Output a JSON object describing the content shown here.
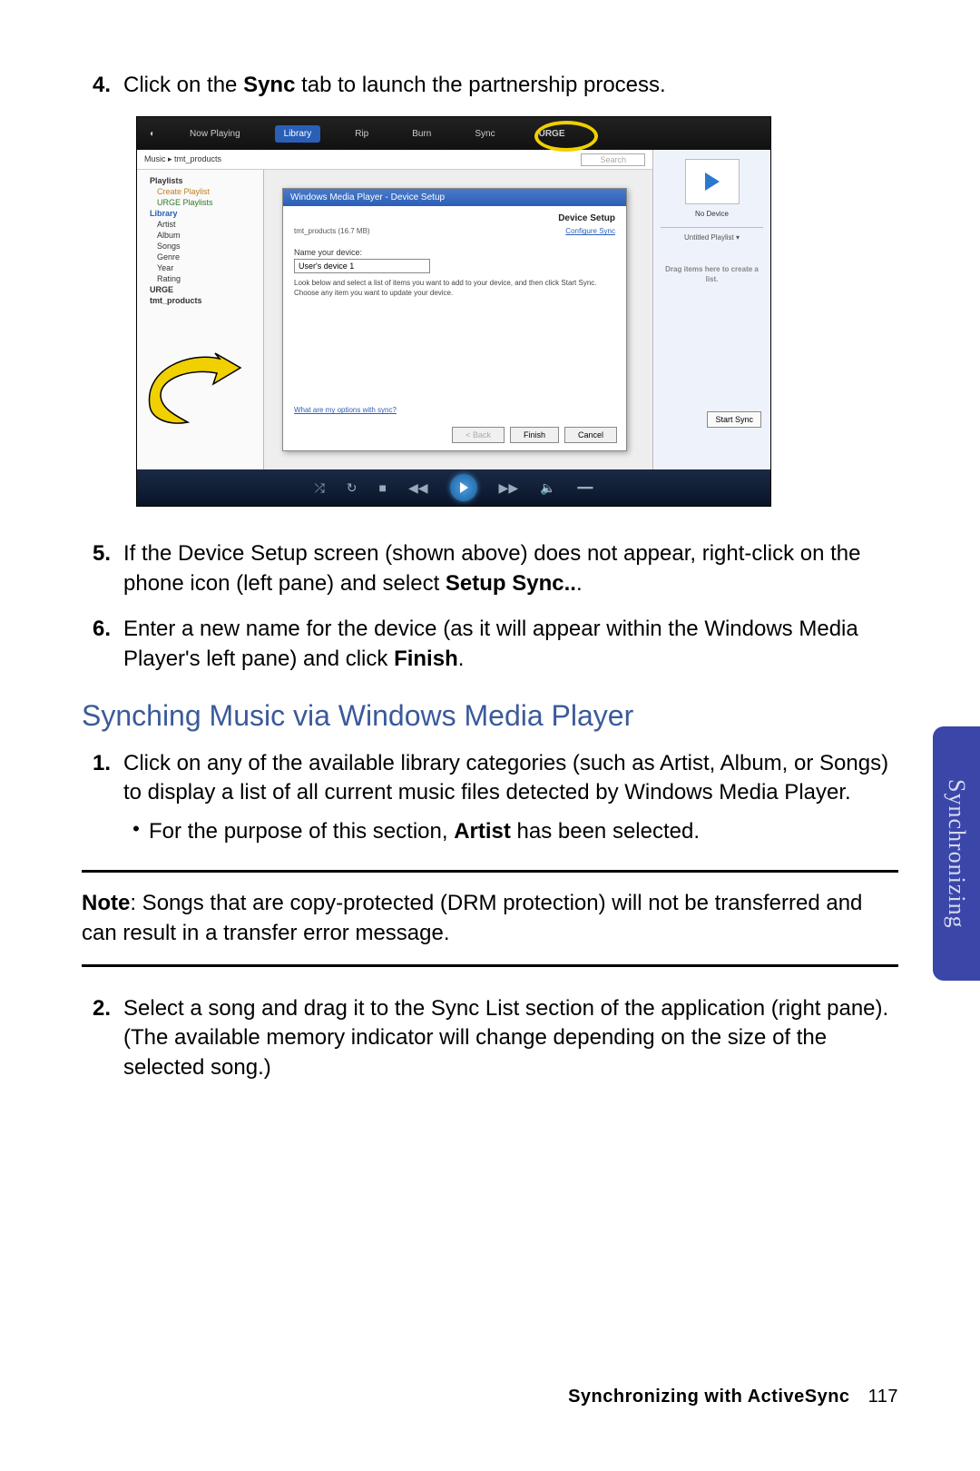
{
  "steps_a": {
    "s4": {
      "num": "4.",
      "pre": "Click on the ",
      "bold": "Sync",
      "post": " tab to launch the partnership process."
    },
    "s5": {
      "num": "5.",
      "pre": "If the Device Setup screen (shown above) does not appear, right-click on the phone icon (left pane) and select ",
      "bold": "Setup Sync..",
      "post": "."
    },
    "s6": {
      "num": "6.",
      "pre": "Enter a new name for the device (as it will appear within the Windows Media Player's left pane) and click ",
      "bold": "Finish",
      "post": "."
    }
  },
  "section_heading": "Synching Music via Windows Media Player",
  "steps_b": {
    "s1": {
      "num": "1.",
      "text": "Click on any of the available library categories (such as Artist, Album, or Songs) to display a list of all current music files detected by Windows Media Player."
    },
    "s1_bullet": {
      "pre": "For the purpose of this section, ",
      "bold": "Artist",
      "post": " has been selected."
    },
    "s2": {
      "num": "2.",
      "text": "Select a song and drag it to the Sync List section of the application (right pane). (The available memory indicator will change depending on the size of the selected song.)"
    }
  },
  "note": {
    "label": "Note",
    "text": ": Songs that are copy-protected (DRM protection) will not be transferred and can result in a transfer error message."
  },
  "side_tab": "Synchronizing",
  "footer": {
    "title": "Synchronizing with ActiveSync",
    "page": "117"
  },
  "wmp": {
    "app_title": "Windows Media Player",
    "top_tabs": [
      "Now Playing",
      "Library",
      "Rip",
      "Burn",
      "Sync",
      "URGE"
    ],
    "breadcrumb": "Music ▸ tmt_products",
    "search_mode": "Search",
    "tree": [
      "Playlists",
      "Create Playlist",
      "URGE Playlists",
      "Library",
      "Artist",
      "Album",
      "Songs",
      "Genre",
      "Year",
      "Rating",
      "URGE",
      "tmt_products"
    ],
    "dialog": {
      "titlebar": "Windows Media Player - Device Setup",
      "heading": "Device Setup",
      "device_line_left": "tmt_products (16.7 MB)",
      "device_line_right": "Configure Sync",
      "name_label": "Name your device:",
      "name_value": "User's device 1",
      "help_text": "Look below and select a list of items you want to add to your device, and then click Start Sync. Choose any item you want to update your device.",
      "link": "What are my options with sync?",
      "btn_back": "< Back",
      "btn_finish": "Finish",
      "btn_cancel": "Cancel"
    },
    "right": {
      "no_device": "No Device",
      "untitled": "Untitled Playlist  ▾",
      "drag": "Drag items here to create a list.",
      "start_sync": "Start Sync"
    }
  }
}
